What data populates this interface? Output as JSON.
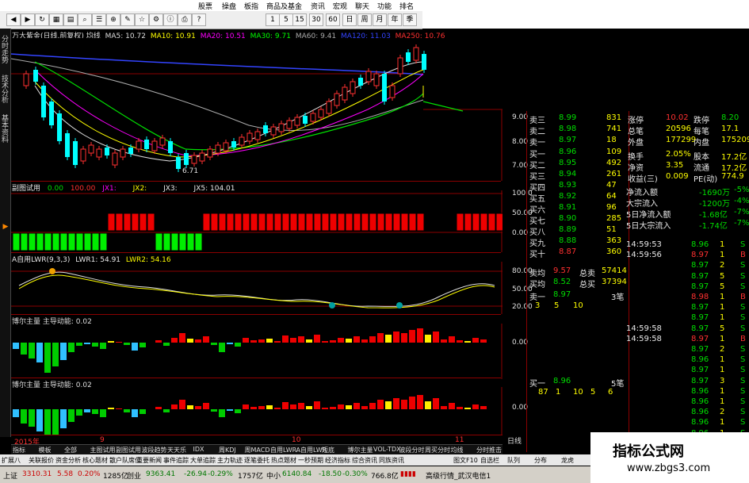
{
  "menu": {
    "items": [
      "股票",
      "操盘",
      "板指",
      "商品及基金",
      "资讯",
      "宏观",
      "聊天",
      "功能",
      "排名"
    ]
  },
  "toolbar": {
    "buttons": [
      "1",
      "5",
      "15",
      "30",
      "60",
      "日",
      "周",
      "月",
      "年",
      "季"
    ]
  },
  "left_tabs": [
    "分时走势",
    "技术分析",
    "基本资料"
  ],
  "main_chart": {
    "title": "万大紫金(日线,前复权) 均线",
    "ma5": "MA5: 10.72",
    "ma10": "MA10: 10.91",
    "ma20": "MA20: 10.51",
    "ma30": "MA30: 9.71",
    "ma60": "MA60: 9.41",
    "ma120": "MA120: 11.03",
    "ma250": "MA250: 10.76",
    "low_label": "6.71",
    "y_ticks": [
      "9.00",
      "8.00",
      "7.00"
    ]
  },
  "ind1": {
    "title": "副图试用",
    "v1": "0.00",
    "v2": "100.00",
    "jx1": "JX1:",
    "jx2": "JX2:",
    "jx3": "JX3:",
    "jx5": "JX5: 104.01",
    "y_ticks": [
      "100.0",
      "50.00",
      "0.00"
    ]
  },
  "ind2": {
    "title": "A自用LWR(9,3,3)",
    "lwr1": "LWR1: 54.91",
    "lwr2": "LWR2: 54.16",
    "y_ticks": [
      "80.00",
      "50.00",
      "20.00"
    ]
  },
  "ind3": {
    "title": "博尔主量  主导动能: 0.02",
    "y_ticks": [
      "0.00"
    ]
  },
  "ind4": {
    "title": "博尔主量  主导动能: 0.02",
    "y_ticks": [
      "0.00"
    ]
  },
  "date_axis": {
    "labels": [
      "2015年",
      "9",
      "10",
      "11"
    ],
    "right": "日线"
  },
  "order_book": {
    "sell": [
      {
        "label": "卖三",
        "price": "8.99",
        "vol": "831"
      },
      {
        "label": "卖二",
        "price": "8.98",
        "vol": "741"
      },
      {
        "label": "卖一",
        "price": "8.97",
        "vol": "18"
      }
    ],
    "buy": [
      {
        "label": "买一",
        "price": "8.96",
        "vol": "109"
      },
      {
        "label": "买二",
        "price": "8.95",
        "vol": "492"
      },
      {
        "label": "买三",
        "price": "8.94",
        "vol": "261"
      },
      {
        "label": "买四",
        "price": "8.93",
        "vol": "47"
      },
      {
        "label": "买五",
        "price": "8.92",
        "vol": "64"
      },
      {
        "label": "买六",
        "price": "8.91",
        "vol": "96"
      },
      {
        "label": "买七",
        "price": "8.90",
        "vol": "285"
      },
      {
        "label": "买八",
        "price": "8.89",
        "vol": "51"
      },
      {
        "label": "买九",
        "price": "8.88",
        "vol": "363"
      },
      {
        "label": "买十",
        "price": "8.87",
        "vol": "360"
      }
    ],
    "avg_sell_label": "卖均",
    "avg_sell": "9.57",
    "total_sell_label": "总卖",
    "total_sell": "57414",
    "avg_buy_label": "买均",
    "avg_buy": "8.52",
    "total_buy_label": "总买",
    "total_buy": "37394",
    "queue_sell_label": "卖一",
    "queue_sell_price": "8.97",
    "queue_sell_count": "3笔",
    "queue_sell_nums": [
      "3",
      "5",
      "10"
    ],
    "queue_buy_label": "买一",
    "queue_buy_price": "8.96",
    "queue_buy_count": "5笔",
    "queue_buy_nums": [
      "87",
      "1",
      "10",
      "5",
      "6"
    ]
  },
  "stats": [
    {
      "l1": "涨停",
      "v1": "10.02",
      "l2": "跌停",
      "v2": "8.20"
    },
    {
      "l1": "总笔",
      "v1": "20596",
      "l2": "每笔",
      "v2": "17.1"
    },
    {
      "l1": "外盘",
      "v1": "177299",
      "l2": "内盘",
      "v2": "175209"
    },
    {
      "l1": "换手",
      "v1": "2.05%",
      "l2": "股本",
      "v2": "17.2亿"
    },
    {
      "l1": "净资",
      "v1": "3.35",
      "l2": "流通",
      "v2": "17.2亿"
    },
    {
      "l1": "收益(三)",
      "v1": "0.009",
      "l2": "PE(动)",
      "v2": "774.9"
    }
  ],
  "flows": [
    {
      "label": "净流入额",
      "val": "-1690万",
      "pct": "-5%"
    },
    {
      "label": "大宗流入",
      "val": "-1200万",
      "pct": "-4%"
    },
    {
      "label": "5日净流入额",
      "val": "-1.68亿",
      "pct": "-7%"
    },
    {
      "label": "5日大宗流入",
      "val": "-1.74亿",
      "pct": "-7%"
    }
  ],
  "ticks": [
    {
      "time": "14:59:53",
      "price": "8.96",
      "vol": "1",
      "side": "S"
    },
    {
      "time": "14:59:56",
      "price": "8.97",
      "vol": "1",
      "side": "B"
    },
    {
      "time": "",
      "price": "8.97",
      "vol": "2",
      "side": "S"
    },
    {
      "time": "",
      "price": "8.97",
      "vol": "5",
      "side": "S"
    },
    {
      "time": "",
      "price": "8.97",
      "vol": "5",
      "side": "S"
    },
    {
      "time": "",
      "price": "8.98",
      "vol": "1",
      "side": "B"
    },
    {
      "time": "",
      "price": "8.97",
      "vol": "1",
      "side": "S"
    },
    {
      "time": "",
      "price": "8.97",
      "vol": "1",
      "side": "S"
    },
    {
      "time": "14:59:58",
      "price": "8.97",
      "vol": "5",
      "side": "S"
    },
    {
      "time": "14:59:58",
      "price": "8.97",
      "vol": "1",
      "side": "B"
    },
    {
      "time": "",
      "price": "8.97",
      "vol": "2",
      "side": "S"
    },
    {
      "time": "",
      "price": "8.96",
      "vol": "1",
      "side": "S"
    },
    {
      "time": "",
      "price": "8.97",
      "vol": "1",
      "side": "S"
    },
    {
      "time": "",
      "price": "8.97",
      "vol": "3",
      "side": "S"
    },
    {
      "time": "",
      "price": "8.96",
      "vol": "1",
      "side": "S"
    },
    {
      "time": "",
      "price": "8.96",
      "vol": "1",
      "side": "S"
    },
    {
      "time": "",
      "price": "8.96",
      "vol": "2",
      "side": "S"
    },
    {
      "time": "",
      "price": "8.96",
      "vol": "1",
      "side": "S"
    },
    {
      "time": "",
      "price": "8.96",
      "vol": "1",
      "side": "S"
    },
    {
      "time": "",
      "price": "8.96",
      "vol": "3",
      "side": "B"
    }
  ],
  "bottom_tabs": [
    "扩展八",
    "关联报价",
    "资金分析",
    "核心题材",
    "散户队席位",
    "重要新闻",
    "事件追踪",
    "大单追踪",
    "主力轨迹",
    "逐笔委托",
    "热点题材",
    "一秒预期",
    "经济指标",
    "综合资讯",
    "同族资讯",
    "图文F10",
    "自选栏",
    "队列",
    "分布",
    "龙虎"
  ],
  "sub_tabs": [
    "指标",
    "模板",
    "全部",
    "主图试用",
    "副图试用",
    "波段趋势",
    "天天乐",
    "IDX",
    "周KDJ",
    "周MACD",
    "自用LWR",
    "A自用LWR",
    "短底",
    "博尔主量",
    "VOL-TDX",
    "波段分时",
    "周买分时",
    "均线",
    "分时推击"
  ],
  "status": {
    "sh": "上证",
    "sh_val": "3310.31",
    "sh_chg": "5.58",
    "sh_pct": "0.20%",
    "sh_amt": "1285亿",
    "sz": "创业",
    "sz_val": "9363.41",
    "sz_chg": "-26.94",
    "sz_pct": "-0.29%",
    "sz_amt": "1757亿",
    "zx": "中小",
    "zx_val": "6140.84",
    "zx_chg": "-18.50",
    "zx_pct": "-0.30%",
    "zx_amt": "766.8亿",
    "broker": "高级行情_武汉电信1"
  },
  "watermark": {
    "title": "指标公式网",
    "url": "www.zbgs3.com"
  }
}
